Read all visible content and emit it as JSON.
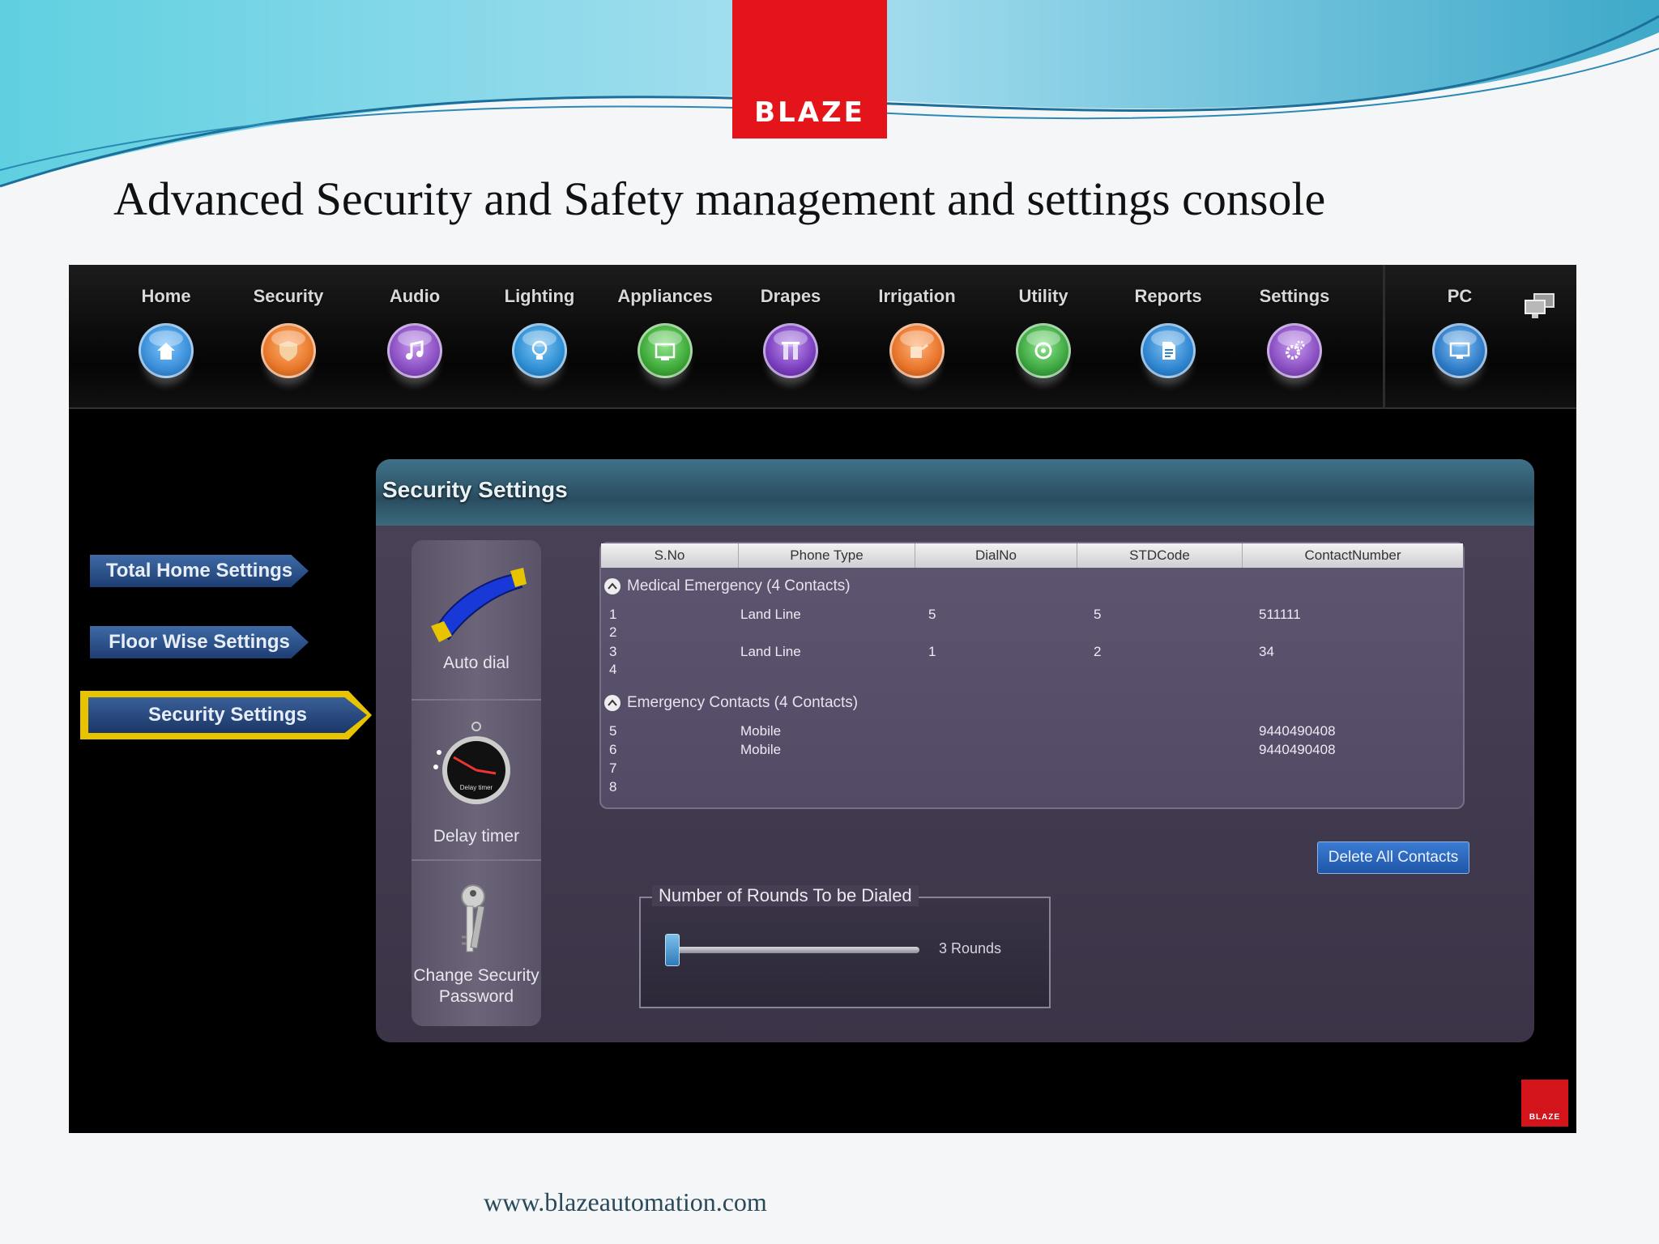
{
  "slide": {
    "brand": "BLAZE",
    "title": "Advanced Security and Safety management and settings console",
    "footer_url": "www.blazeautomation.com"
  },
  "nav": {
    "items": [
      {
        "label": "Home",
        "icon": "home-icon",
        "color": "#3a8fd8"
      },
      {
        "label": "Security",
        "icon": "shield-icon",
        "color": "#e8782a"
      },
      {
        "label": "Audio",
        "icon": "music-note-icon",
        "color": "#8a4fc2"
      },
      {
        "label": "Lighting",
        "icon": "bulb-icon",
        "color": "#2f8fd4"
      },
      {
        "label": "Appliances",
        "icon": "tv-icon",
        "color": "#3faa3a"
      },
      {
        "label": "Drapes",
        "icon": "drapes-icon",
        "color": "#7b3fbf"
      },
      {
        "label": "Irrigation",
        "icon": "watering-can-icon",
        "color": "#e8742a"
      },
      {
        "label": "Utility",
        "icon": "utility-icon",
        "color": "#3ea842"
      },
      {
        "label": "Reports",
        "icon": "report-icon",
        "color": "#2f86d0"
      },
      {
        "label": "Settings",
        "icon": "gear-icon",
        "color": "#8a4fc2"
      },
      {
        "label": "PC",
        "icon": "monitor-icon",
        "color": "#2f7cc8"
      }
    ]
  },
  "sidebar": {
    "items": [
      {
        "label": "Total Home Settings"
      },
      {
        "label": "Floor Wise Settings"
      },
      {
        "label": "Security Settings",
        "active": true
      }
    ]
  },
  "panel": {
    "title": "Security Settings",
    "tools": [
      {
        "label": "Auto dial",
        "icon": "phone-handset-icon"
      },
      {
        "label": "Delay timer",
        "icon": "stopwatch-icon",
        "dial_text": "Delay timer"
      },
      {
        "label": "Change Security",
        "label2": "Password",
        "icon": "keys-icon"
      }
    ],
    "table": {
      "columns": [
        "S.No",
        "Phone Type",
        "DialNo",
        "STDCode",
        "ContactNumber"
      ],
      "groups": [
        {
          "title": "Medical Emergency (4 Contacts)",
          "rows": [
            {
              "sno": "1",
              "type": "Land Line",
              "dial": "5",
              "std": "5",
              "number": "511111"
            },
            {
              "sno": "2",
              "type": "",
              "dial": "",
              "std": "",
              "number": ""
            },
            {
              "sno": "3",
              "type": "Land Line",
              "dial": "1",
              "std": "2",
              "number": "34"
            },
            {
              "sno": "4",
              "type": "",
              "dial": "",
              "std": "",
              "number": ""
            }
          ]
        },
        {
          "title": "Emergency Contacts (4 Contacts)",
          "rows": [
            {
              "sno": "5",
              "type": "Mobile",
              "dial": "",
              "std": "",
              "number": "9440490408"
            },
            {
              "sno": "6",
              "type": "Mobile",
              "dial": "",
              "std": "",
              "number": "9440490408"
            },
            {
              "sno": "7",
              "type": "",
              "dial": "",
              "std": "",
              "number": ""
            },
            {
              "sno": "8",
              "type": "",
              "dial": "",
              "std": "",
              "number": ""
            }
          ]
        }
      ]
    },
    "delete_button": "Delete All Contacts",
    "rounds": {
      "legend": "Number of Rounds To be Dialed",
      "value_text": "3 Rounds",
      "fraction": 0.03
    }
  }
}
